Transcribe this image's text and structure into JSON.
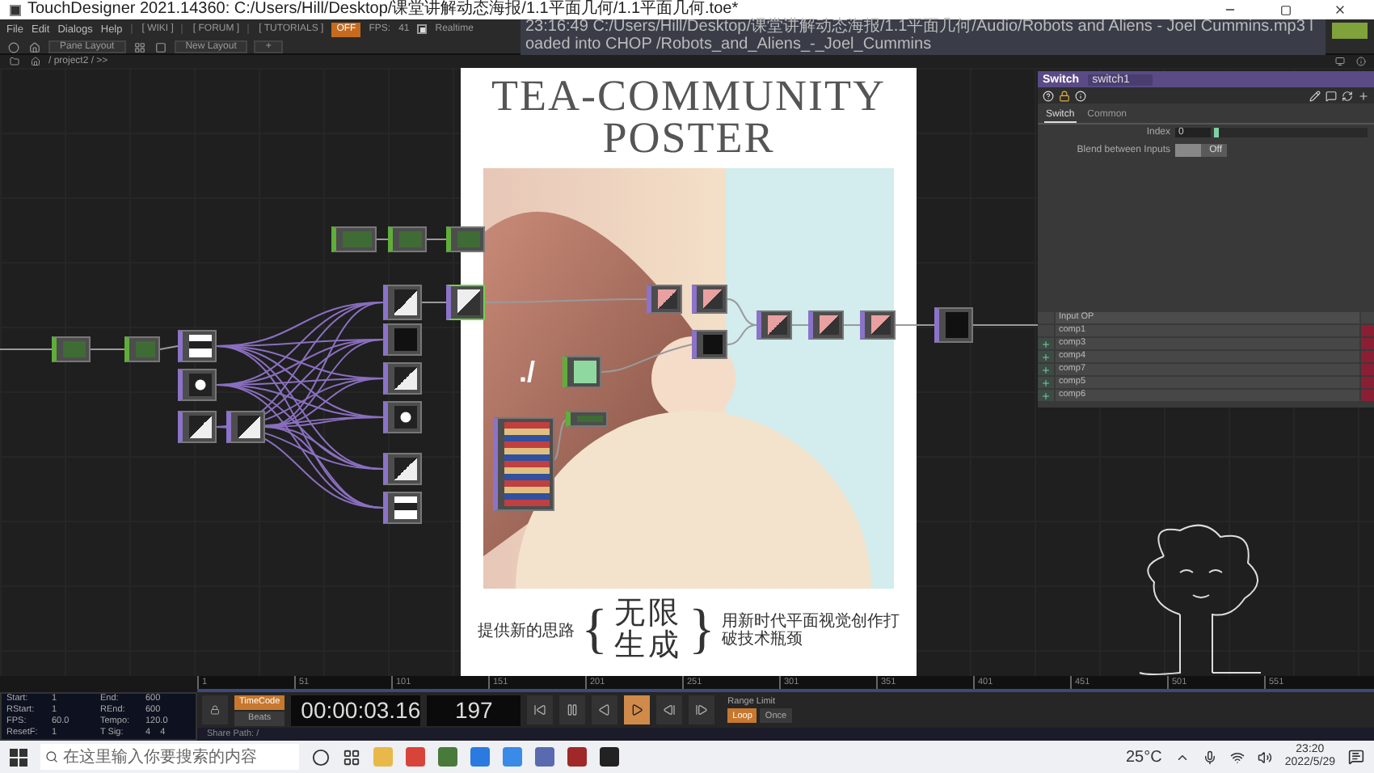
{
  "window": {
    "title": "TouchDesigner 2021.14360: C:/Users/Hill/Desktop/课堂讲解动态海报/1.1平面几何/1.1平面几何.toe*"
  },
  "menu": [
    "File",
    "Edit",
    "Dialogs",
    "Help"
  ],
  "links": [
    "[ WIKI ]",
    "[ FORUM ]",
    "[ TUTORIALS ]"
  ],
  "cook_toggle": {
    "label": "OFF",
    "on": true
  },
  "fps": {
    "label": "FPS:",
    "value": "41"
  },
  "realtime": {
    "label": "Realtime",
    "checked": true
  },
  "status_message": "23:16:49 C:/Users/Hill/Desktop/课堂讲解动态海报/1.1平面几何/Audio/Robots and Aliens - Joel Cummins.mp3 loaded into CHOP /Robots_and_Aliens_-_Joel_Cummins",
  "pane_bar": {
    "pane_layout": "Pane Layout",
    "new_layout": "New Layout",
    "add": "+"
  },
  "path_bar": {
    "path": "/ project2 / >>"
  },
  "poster": {
    "title_lines": [
      "TEA-COMMUNITY",
      "POSTER"
    ],
    "image_caption": "./",
    "left_text": "提供新的思路",
    "brace_open": "{",
    "slogan_lines": [
      "无限",
      "生成"
    ],
    "brace_close": "}",
    "right_text": "用新时代平面视觉创作打破技术瓶颈"
  },
  "parameters": {
    "op_type": "Switch",
    "op_name": "switch1",
    "tabs": [
      {
        "label": "Switch",
        "selected": true
      },
      {
        "label": "Common",
        "selected": false
      }
    ],
    "index": {
      "label": "Index",
      "value": "0",
      "level": 0
    },
    "blend": {
      "label": "Blend between Inputs",
      "value": "Off",
      "on": false
    },
    "inputs": {
      "header": "Input OP",
      "rows": [
        {
          "name": "comp1",
          "add": false
        },
        {
          "name": "comp3",
          "add": true
        },
        {
          "name": "comp4",
          "add": true
        },
        {
          "name": "comp7",
          "add": true
        },
        {
          "name": "comp5",
          "add": true
        },
        {
          "name": "comp6",
          "add": true
        }
      ]
    }
  },
  "timeline": {
    "info": [
      {
        "label": "Start:",
        "value": "1"
      },
      {
        "label": "End:",
        "value": "600"
      },
      {
        "label": "RStart:",
        "value": "1"
      },
      {
        "label": "REnd:",
        "value": "600"
      },
      {
        "label": "FPS:",
        "value": "60.0"
      },
      {
        "label": "Tempo:",
        "value": "120.0"
      },
      {
        "label": "ResetF:",
        "value": "1"
      },
      {
        "label": "T Sig:",
        "value": "4    4"
      }
    ],
    "ruler": [
      "1",
      "51",
      "101",
      "151",
      "201",
      "251",
      "301",
      "351",
      "401",
      "451",
      "501",
      "551"
    ],
    "time_mode": [
      {
        "label": "TimeCode",
        "selected": true
      },
      {
        "label": "Beats",
        "selected": false
      }
    ],
    "timecode": "00:00:03.16",
    "frame": "197",
    "transport": [
      {
        "kind": "start",
        "selected": false
      },
      {
        "kind": "pause",
        "selected": false
      },
      {
        "kind": "reverse",
        "selected": false
      },
      {
        "kind": "play",
        "selected": true
      },
      {
        "kind": "step_back",
        "selected": false
      },
      {
        "kind": "step_forward",
        "selected": false
      }
    ],
    "range_label": "Range Limit",
    "range": [
      {
        "label": "Loop",
        "selected": true
      },
      {
        "label": "Once",
        "selected": false
      }
    ],
    "share_path": "Share Path: /"
  },
  "taskbar": {
    "search_placeholder": "在这里输入你要搜索的内容",
    "weather": "25°C",
    "time": "23:20",
    "date": "2022/5/29"
  }
}
